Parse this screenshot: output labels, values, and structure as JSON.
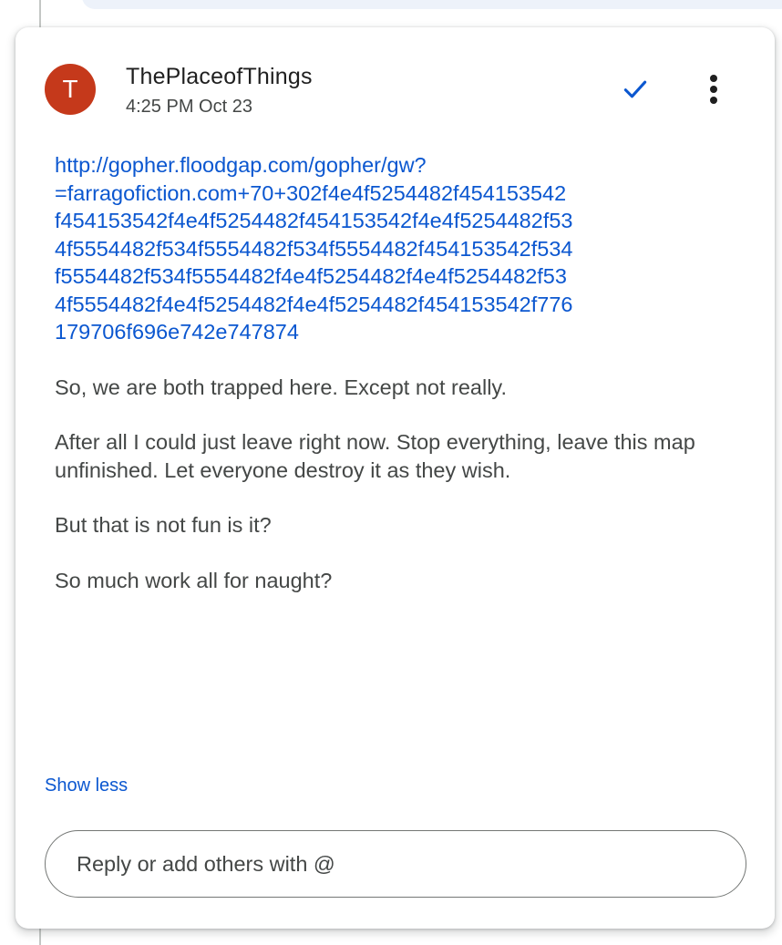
{
  "comment": {
    "author": {
      "initial": "T",
      "name": "ThePlaceofThings",
      "avatar_color": "#c5391b"
    },
    "timestamp": "4:25 PM Oct 23",
    "icons": {
      "resolve": "check-icon",
      "more": "more-vert-icon"
    },
    "link_lines": [
      "http://gopher.floodgap.com/gopher/gw?",
      "=farragofiction.com+70+302f4e4f5254482f454153542",
      "f454153542f4e4f5254482f454153542f4e4f5254482f53",
      "4f5554482f534f5554482f534f5554482f454153542f534",
      "f5554482f534f5554482f4e4f5254482f4e4f5254482f53",
      "4f5554482f4e4f5254482f4e4f5254482f454153542f776",
      "179706f696e742e747874"
    ],
    "paragraphs": [
      "So, we are both trapped here. Except not really.",
      "After all I could just leave right now. Stop everything, leave this map unfinished. Let everyone destroy it as they wish.",
      "But that is not fun is it?",
      "So much work all for naught?"
    ],
    "show_less_label": "Show less",
    "reply": {
      "placeholder": "Reply or add others with @",
      "value": ""
    }
  },
  "colors": {
    "link": "#0b57d0",
    "accent": "#0b57d0"
  }
}
